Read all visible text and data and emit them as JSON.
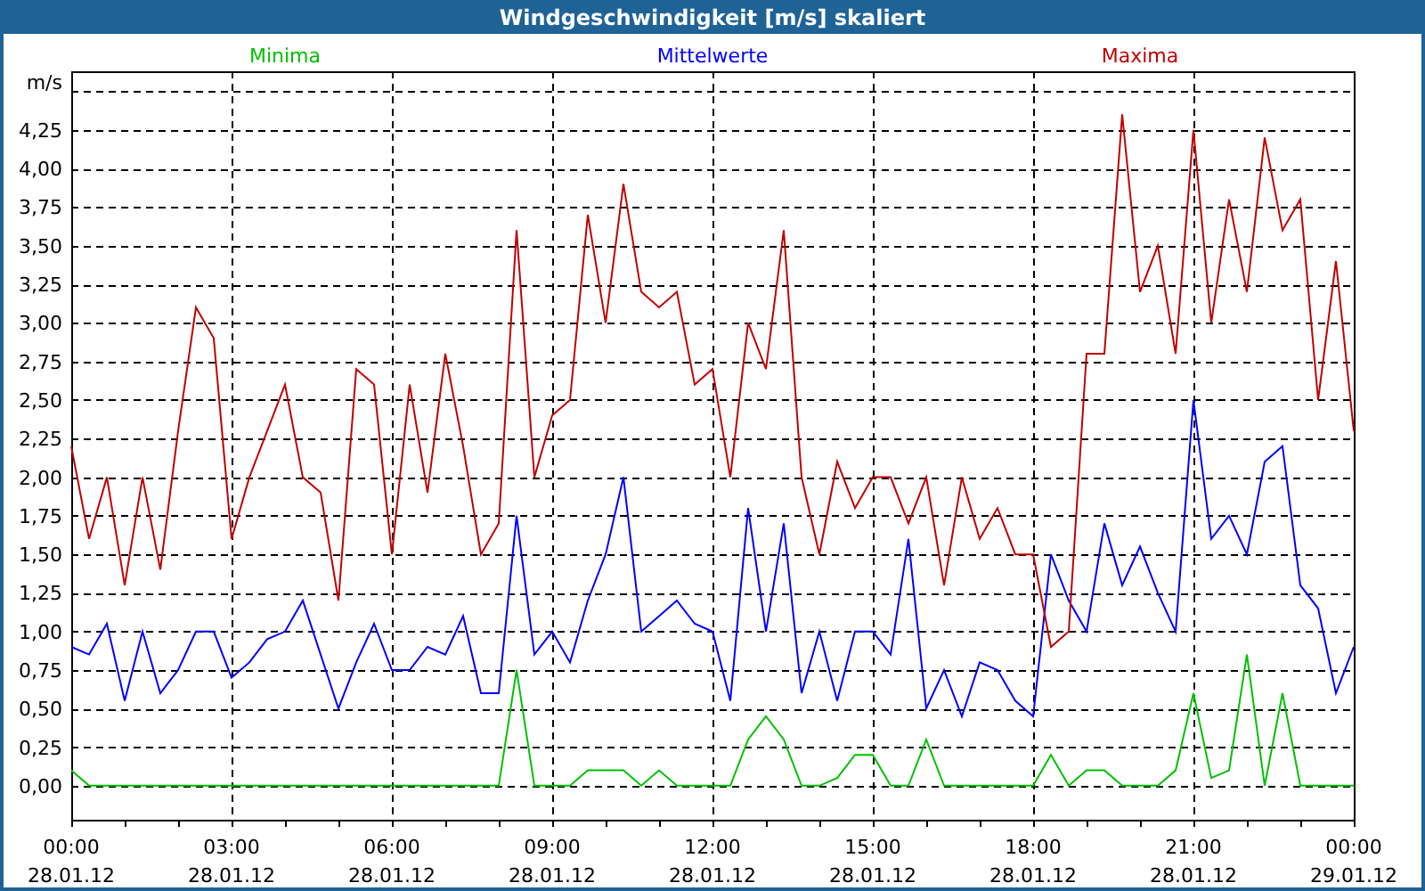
{
  "window": {
    "title": "Windgeschwindigkeit [m/s] skaliert"
  },
  "chart": {
    "chart_data": {
      "type": "line",
      "ylabel": "m/s",
      "categories": [
        "00:00 28.01.12",
        null,
        null,
        null,
        null,
        null,
        null,
        null,
        null,
        "03:00 28.01.12",
        null,
        null,
        null,
        null,
        null,
        null,
        null,
        null,
        "06:00 28.01.12",
        null,
        null,
        null,
        null,
        null,
        null,
        null,
        null,
        "09:00 28.01.12",
        null,
        null,
        null,
        null,
        null,
        null,
        null,
        null,
        "12:00 28.01.12",
        null,
        null,
        null,
        null,
        null,
        null,
        null,
        null,
        "15:00 28.01.12",
        null,
        null,
        null,
        null,
        null,
        null,
        null,
        null,
        "18:00 28.01.12",
        null,
        null,
        null,
        null,
        null,
        null,
        null,
        null,
        "21:00 28.01.12",
        null,
        null,
        null,
        null,
        null,
        null,
        null,
        null,
        "00:00 29.01.12"
      ],
      "series": [
        {
          "name": "Minima",
          "color": "#00c000",
          "values": [
            0.1,
            0,
            0,
            0,
            0,
            0,
            0,
            0,
            0,
            0,
            0,
            0,
            0,
            0,
            0,
            0,
            0,
            0,
            0,
            0,
            0,
            0,
            0,
            0,
            0,
            0.75,
            0,
            0,
            0,
            0.1,
            0.1,
            0.1,
            0,
            0.1,
            0,
            0,
            0,
            0,
            0.3,
            0.45,
            0.3,
            0,
            0,
            0.05,
            0.2,
            0.2,
            0,
            0,
            0.3,
            0,
            0,
            0,
            0,
            0,
            0,
            0.2,
            0,
            0.1,
            0.1,
            0,
            0,
            0,
            0.1,
            0.6,
            0.05,
            0.1,
            0.85,
            0,
            0.6,
            0,
            0,
            0,
            0
          ]
        },
        {
          "name": "Mittelwerte",
          "color": "#0000ff",
          "values": [
            0.9,
            0.85,
            1.05,
            0.55,
            1.0,
            0.6,
            0.75,
            1.0,
            1.0,
            0.7,
            0.8,
            0.95,
            1.0,
            1.2,
            0.85,
            0.5,
            0.8,
            1.05,
            0.75,
            0.75,
            0.9,
            0.85,
            1.1,
            0.6,
            0.6,
            1.75,
            0.85,
            1.0,
            0.8,
            1.2,
            1.5,
            2.0,
            1.0,
            1.1,
            1.2,
            1.05,
            1.0,
            0.55,
            1.8,
            1.0,
            1.7,
            0.6,
            1.0,
            0.55,
            1.0,
            1.0,
            0.85,
            1.6,
            0.5,
            0.75,
            0.45,
            0.8,
            0.75,
            0.55,
            0.45,
            1.5,
            1.2,
            1.0,
            1.7,
            1.3,
            1.55,
            1.25,
            1.0,
            2.5,
            1.6,
            1.75,
            1.5,
            2.1,
            2.2,
            1.3,
            1.15,
            0.6,
            0.9
          ]
        },
        {
          "name": "Maxima",
          "color": "#c00000",
          "values": [
            2.2,
            1.6,
            2.0,
            1.3,
            2.0,
            1.4,
            2.3,
            3.1,
            2.9,
            1.6,
            2.0,
            2.3,
            2.6,
            2.0,
            1.9,
            1.2,
            2.7,
            2.6,
            1.5,
            2.6,
            1.9,
            2.8,
            2.2,
            1.5,
            1.7,
            3.6,
            2.0,
            2.4,
            2.5,
            3.7,
            3.0,
            3.9,
            3.2,
            3.1,
            3.2,
            2.6,
            2.7,
            2.0,
            3.0,
            2.7,
            3.6,
            2.0,
            1.5,
            2.1,
            1.8,
            2.0,
            2.0,
            1.7,
            2.0,
            1.3,
            2.0,
            1.6,
            1.8,
            1.5,
            1.5,
            0.9,
            1.0,
            2.8,
            2.8,
            4.35,
            3.2,
            3.5,
            2.8,
            4.25,
            3.0,
            3.8,
            3.2,
            4.2,
            3.6,
            3.8,
            2.5,
            3.4,
            2.3
          ]
        }
      ],
      "ylim": [
        -0.22,
        4.63
      ],
      "grid": true,
      "yticks": [
        {
          "value": 0,
          "label": "0,00"
        },
        {
          "value": 0.25,
          "label": "0,25"
        },
        {
          "value": 0.5,
          "label": "0,50"
        },
        {
          "value": 0.75,
          "label": "0,75"
        },
        {
          "value": 1,
          "label": "1,00"
        },
        {
          "value": 1.25,
          "label": "1,25"
        },
        {
          "value": 1.5,
          "label": "1,50"
        },
        {
          "value": 1.75,
          "label": "1,75"
        },
        {
          "value": 2,
          "label": "2,00"
        },
        {
          "value": 2.25,
          "label": "2,25"
        },
        {
          "value": 2.5,
          "label": "2,50"
        },
        {
          "value": 2.75,
          "label": "2,75"
        },
        {
          "value": 3,
          "label": "3,00"
        },
        {
          "value": 3.25,
          "label": "3,25"
        },
        {
          "value": 3.5,
          "label": "3,50"
        },
        {
          "value": 3.75,
          "label": "3,75"
        },
        {
          "value": 4,
          "label": "4,00"
        },
        {
          "value": 4.25,
          "label": "4,25"
        }
      ]
    }
  }
}
